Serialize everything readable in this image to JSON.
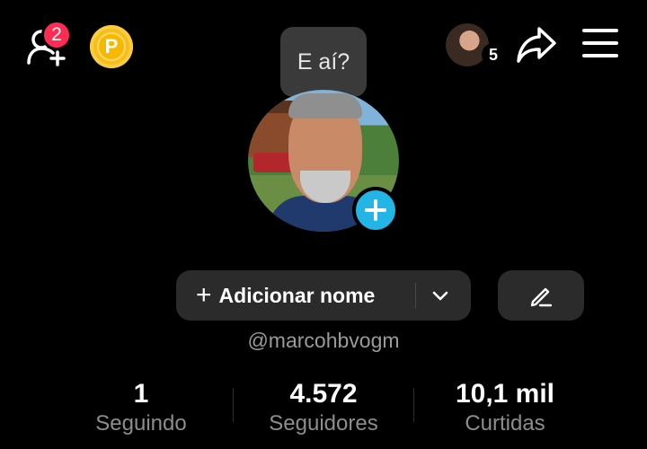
{
  "header": {
    "friend_requests_count": "2",
    "coin_letter": "P",
    "story_viewers_count": "5"
  },
  "tooltip": {
    "text": "E aí?"
  },
  "profile": {
    "add_name_label": "Adicionar nome",
    "username": "@marcohbvogm"
  },
  "stats": [
    {
      "value": "1",
      "label": "Seguindo"
    },
    {
      "value": "4.572",
      "label": "Seguidores"
    },
    {
      "value": "10,1 mil",
      "label": "Curtidas"
    }
  ],
  "colors": {
    "background": "#000000",
    "badge": "#fe2c55",
    "coin": "#f6be1d",
    "add_story": "#22b5e6",
    "button_bg": "#2b2b2b",
    "muted_text": "#8d8d8d"
  }
}
